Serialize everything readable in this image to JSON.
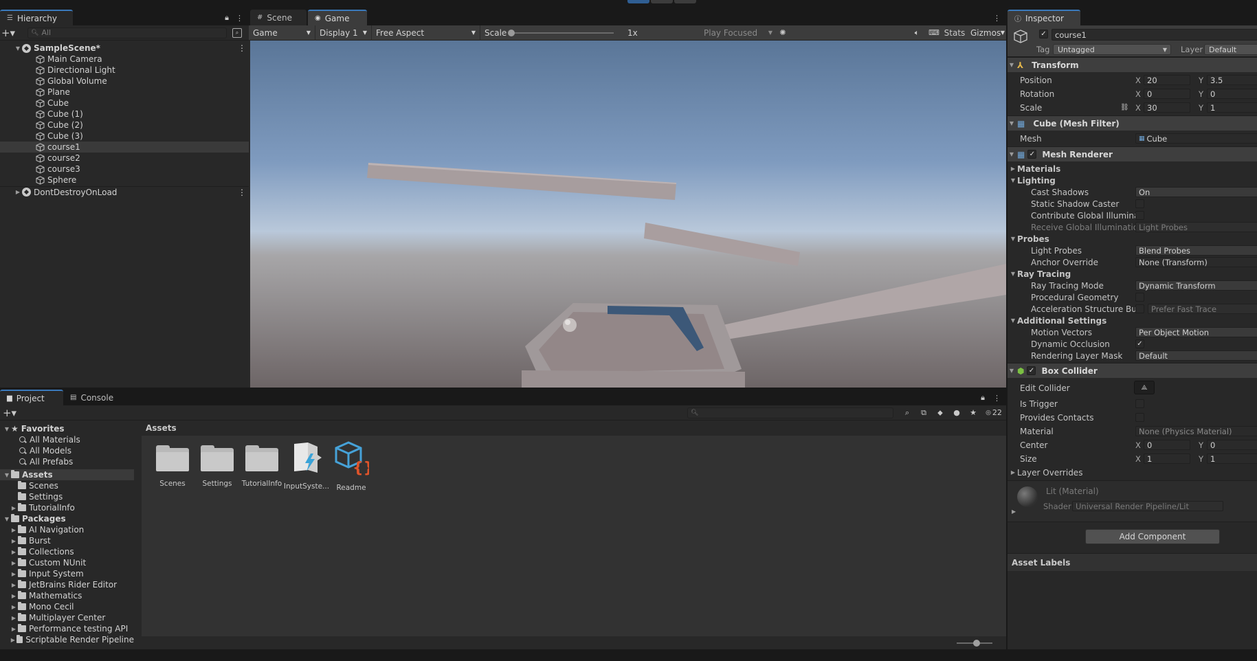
{
  "hierarchy": {
    "tab": "Hierarchy",
    "search_placeholder": "All",
    "scene": "SampleScene*",
    "items": [
      "Main Camera",
      "Directional Light",
      "Global Volume",
      "Plane",
      "Cube",
      "Cube (1)",
      "Cube (2)",
      "Cube (3)",
      "course1",
      "course2",
      "course3",
      "Sphere"
    ],
    "selected": "course1",
    "dontdestroy": "DontDestroyOnLoad"
  },
  "view_tabs": {
    "scene": "Scene",
    "game": "Game"
  },
  "game_toolbar": {
    "game_dd": "Game",
    "display_dd": "Display 1",
    "aspect_dd": "Free Aspect",
    "scale_label": "Scale",
    "scale_value": "1x",
    "play_focused": "Play Focused",
    "stats": "Stats",
    "gizmos": "Gizmos"
  },
  "bottom_tabs": {
    "project": "Project",
    "console": "Console"
  },
  "project": {
    "favorites_label": "Favorites",
    "favorites": [
      "All Materials",
      "All Models",
      "All Prefabs"
    ],
    "assets_label": "Assets",
    "asset_folders": [
      "Scenes",
      "Settings",
      "TutorialInfo"
    ],
    "packages_label": "Packages",
    "packages": [
      "AI Navigation",
      "Burst",
      "Collections",
      "Custom NUnit",
      "Input System",
      "JetBrains Rider Editor",
      "Mathematics",
      "Mono Cecil",
      "Multiplayer Center",
      "Performance testing API",
      "Scriptable Render Pipeline"
    ],
    "breadcrumb": "Assets",
    "items": [
      "Scenes",
      "Settings",
      "TutorialInfo",
      "InputSyste...",
      "Readme"
    ],
    "hidden_count": "22"
  },
  "inspector": {
    "tab": "Inspector",
    "object_name": "course1",
    "tag_label": "Tag",
    "tag_value": "Untagged",
    "layer_label": "Layer",
    "layer_value": "Default",
    "transform": {
      "title": "Transform",
      "position_label": "Position",
      "pos_x": "20",
      "pos_y": "3.5",
      "rotation_label": "Rotation",
      "rot_x": "0",
      "rot_y": "0",
      "scale_label": "Scale",
      "scale_x": "30",
      "scale_y": "1"
    },
    "mesh_filter": {
      "title": "Cube (Mesh Filter)",
      "mesh_label": "Mesh",
      "mesh_value": "Cube"
    },
    "mesh_renderer": {
      "title": "Mesh Renderer",
      "materials": "Materials",
      "lighting": "Lighting",
      "cast_shadows_label": "Cast Shadows",
      "cast_shadows_value": "On",
      "static_shadow_label": "Static Shadow Caster",
      "contribute_gi_label": "Contribute Global Illuminat",
      "receive_gi_label": "Receive Global Illumination",
      "receive_gi_value": "Light Probes",
      "probes": "Probes",
      "light_probes_label": "Light Probes",
      "light_probes_value": "Blend Probes",
      "anchor_label": "Anchor Override",
      "anchor_value": "None (Transform)",
      "ray_tracing": "Ray Tracing",
      "rt_mode_label": "Ray Tracing Mode",
      "rt_mode_value": "Dynamic Transform",
      "proc_geo_label": "Procedural Geometry",
      "accel_label": "Acceleration Structure Bui",
      "accel_value": "Prefer Fast Trace",
      "additional": "Additional Settings",
      "motion_label": "Motion Vectors",
      "motion_value": "Per Object Motion",
      "dyn_occ_label": "Dynamic Occlusion",
      "rlm_label": "Rendering Layer Mask",
      "rlm_value": "Default"
    },
    "box_collider": {
      "title": "Box Collider",
      "edit_label": "Edit Collider",
      "trigger_label": "Is Trigger",
      "contacts_label": "Provides Contacts",
      "material_label": "Material",
      "material_value": "None (Physics Material)",
      "center_label": "Center",
      "center_x": "0",
      "center_y": "0",
      "size_label": "Size",
      "size_x": "1",
      "size_y": "1",
      "layer_overrides": "Layer Overrides"
    },
    "material": {
      "name": "Lit (Material)",
      "shader_label": "Shader",
      "shader_value": "Universal Render Pipeline/Lit"
    },
    "add_component": "Add Component",
    "asset_labels": "Asset Labels"
  }
}
